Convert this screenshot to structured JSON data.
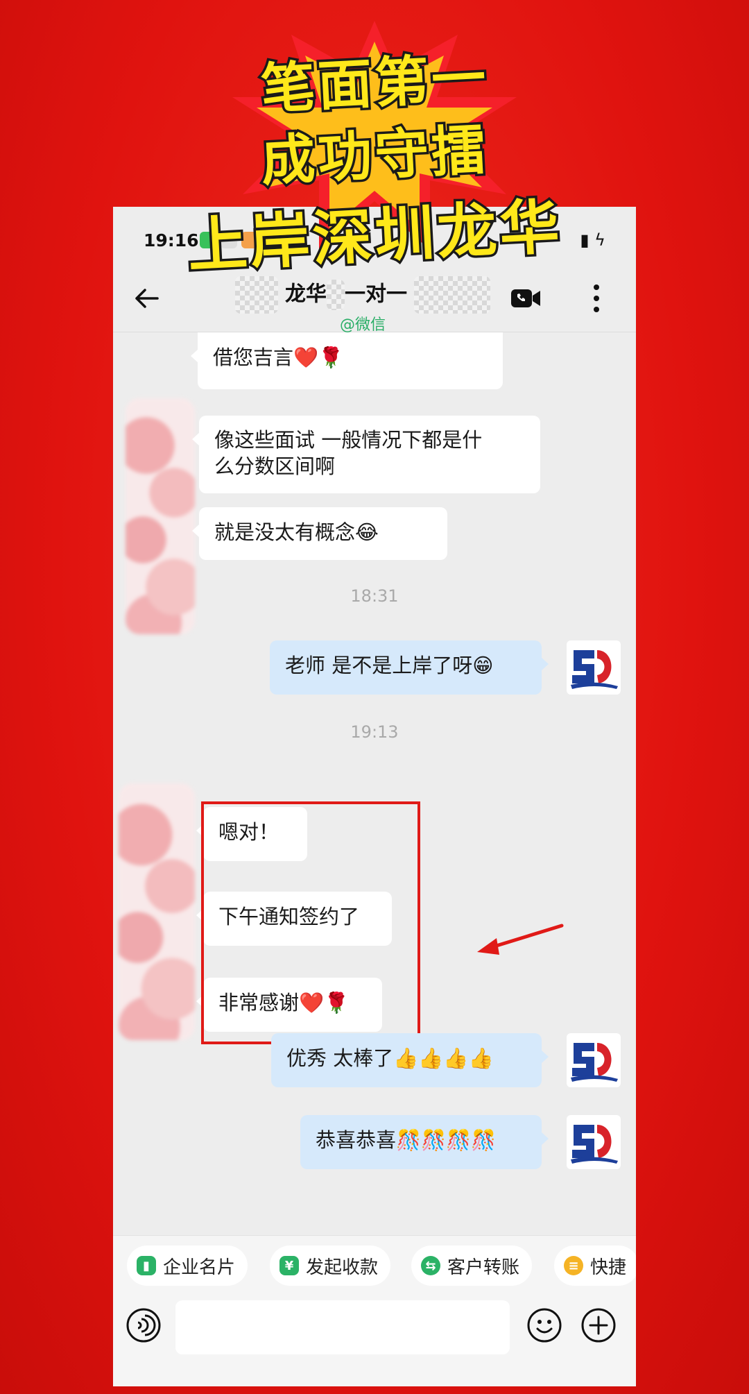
{
  "headline": {
    "line1": "笔面第一",
    "line2": "成功守擂",
    "line3": "上岸深圳龙华"
  },
  "status_bar": {
    "time": "19:16",
    "right": "▮ ϟ"
  },
  "nav": {
    "title_prefix": "龙华",
    "title_mid": "一对一",
    "subtitle": "@微信"
  },
  "messages": {
    "m1": "借您吉言❤️🌹",
    "m2_line1": "像这些面试 一般情况下都是什",
    "m2_line2": "么分数区间啊",
    "m3": "就是没太有概念😂",
    "ts1": "18:31",
    "m4": "老师 是不是上岸了呀😁",
    "ts2": "19:13",
    "m5": "嗯对！",
    "m6": "下午通知签约了",
    "m7": "非常感谢❤️🌹",
    "m8": "优秀 太棒了👍👍👍👍",
    "m9": "恭喜恭喜🎊🎊🎊🎊"
  },
  "toolbar": {
    "chips": [
      {
        "label": "企业名片",
        "color": "#2bb266",
        "glyph": "▮"
      },
      {
        "label": "发起收款",
        "color": "#2bb266",
        "glyph": "¥"
      },
      {
        "label": "客户转账",
        "color": "#2bb266",
        "glyph": "⇆"
      },
      {
        "label": "快捷",
        "color": "#f5b325",
        "glyph": "≡"
      }
    ]
  },
  "colors": {
    "background": "#e31b17",
    "headline": "#ffe81a",
    "outbound_bubble": "#d6e9fb",
    "highlight": "#e01a17"
  }
}
